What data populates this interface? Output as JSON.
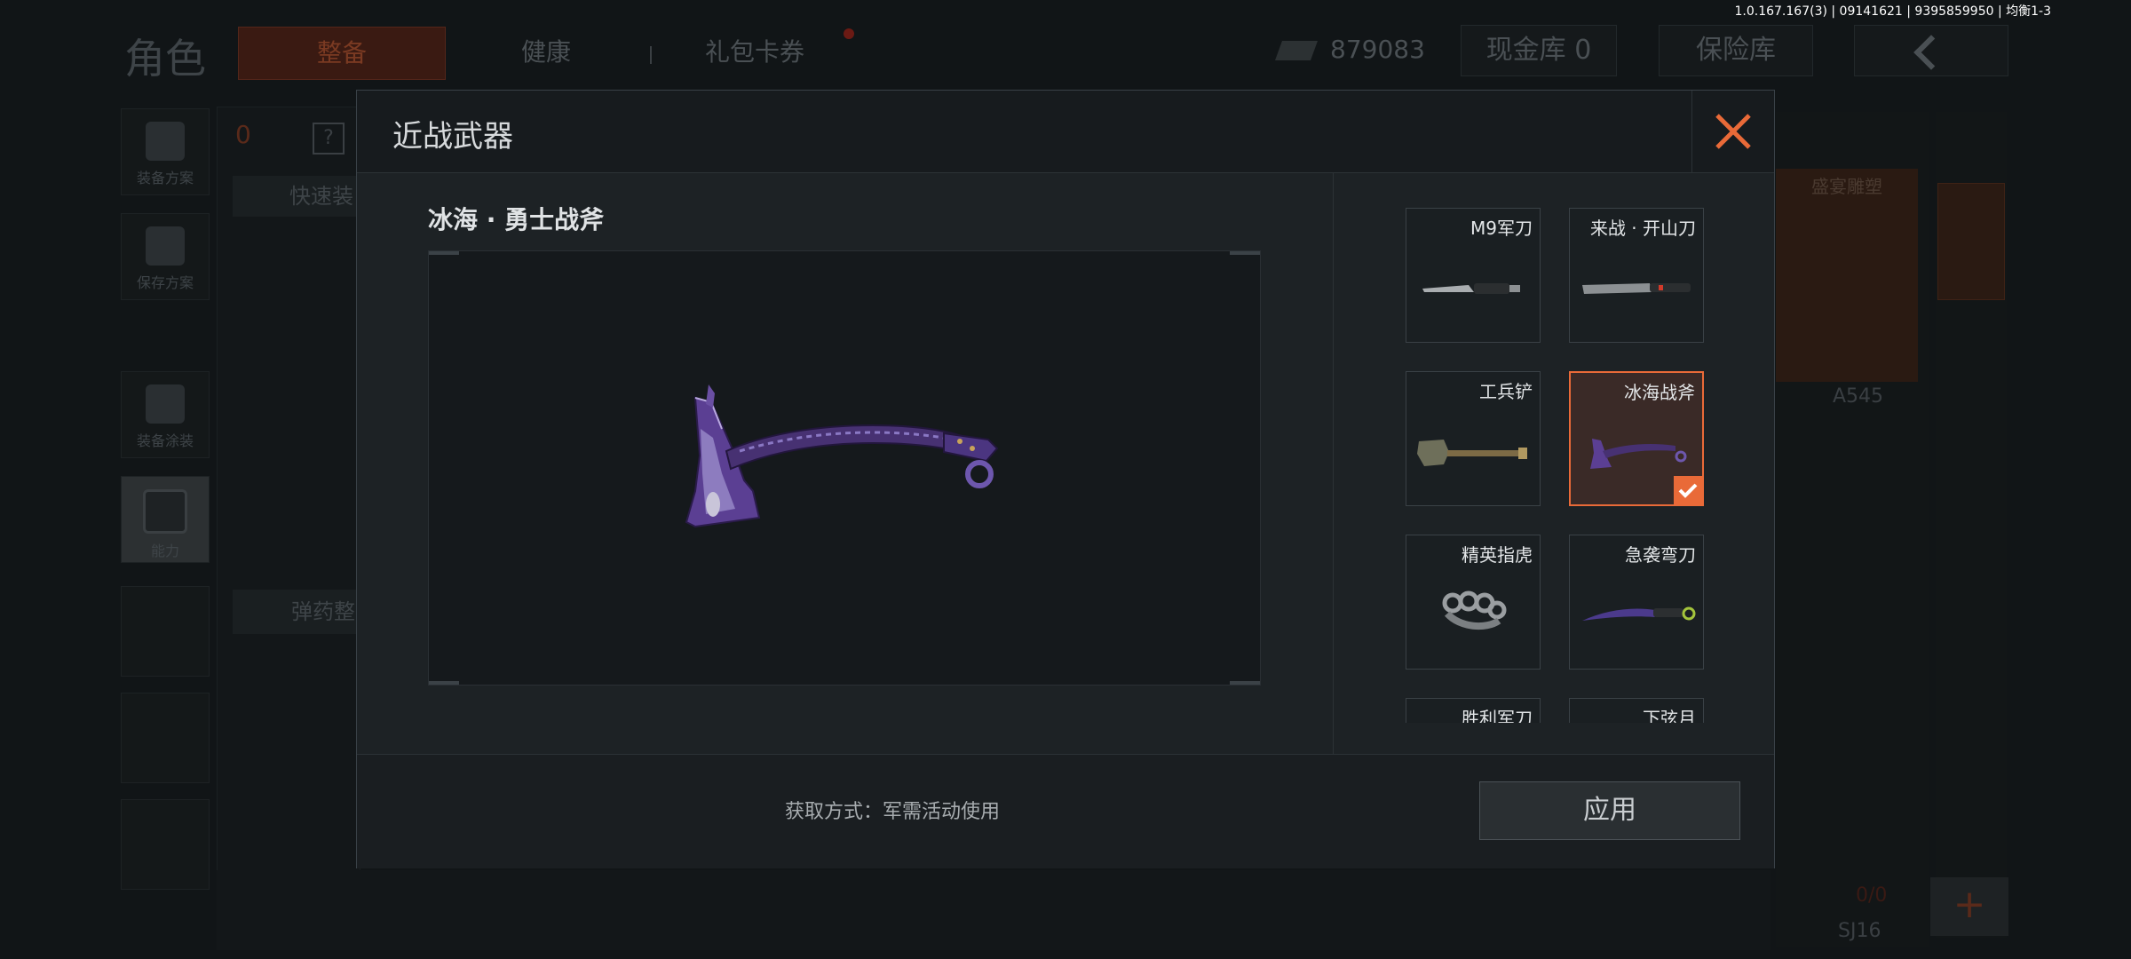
{
  "version_text": "1.0.167.167(3) | 09141621 | 9395859950 | 均衡1-3",
  "background": {
    "role_title": "角色",
    "tabs": [
      "整备",
      "健康",
      "礼包卡券"
    ],
    "money": "879083",
    "vault_label": "现金库 0",
    "safe_label": "保险库",
    "sidebar": [
      {
        "label": "装备方案",
        "icon": "vest-icon"
      },
      {
        "label": "保存方案",
        "icon": "download-icon"
      },
      {
        "label": "装备涂装",
        "icon": "paint-icon"
      },
      {
        "label": "能力",
        "icon": "ability-icon"
      }
    ],
    "left_badge": "0",
    "quick_equip": "快速装",
    "ammo_sort": "弹药整",
    "right_card_title": "盛宴雕塑",
    "right_a545": "A545",
    "right_count": "0/0",
    "right_sj": "SJ16",
    "plus": "+"
  },
  "modal": {
    "title": "近战武器",
    "close_icon": "close-icon",
    "accent_color": "#e96a38",
    "selected_weapon_name": "冰海 · 勇士战斧",
    "items": [
      {
        "label": "M9军刀",
        "thumb": "bayonet-knife",
        "selected": false
      },
      {
        "label": "来战 · 开山刀",
        "thumb": "machete",
        "selected": false
      },
      {
        "label": "工兵铲",
        "thumb": "shovel",
        "selected": false
      },
      {
        "label": "冰海战斧",
        "thumb": "tomahawk",
        "selected": true
      },
      {
        "label": "精英指虎",
        "thumb": "brass-knuckles",
        "selected": false
      },
      {
        "label": "急袭弯刀",
        "thumb": "karambit",
        "selected": false
      },
      {
        "label": "胜利军刀",
        "thumb": "knife",
        "selected": false
      },
      {
        "label": "下弦月",
        "thumb": "blade",
        "selected": false
      }
    ],
    "acquire_text": "获取方式：军需活动使用",
    "apply_label": "应用"
  }
}
